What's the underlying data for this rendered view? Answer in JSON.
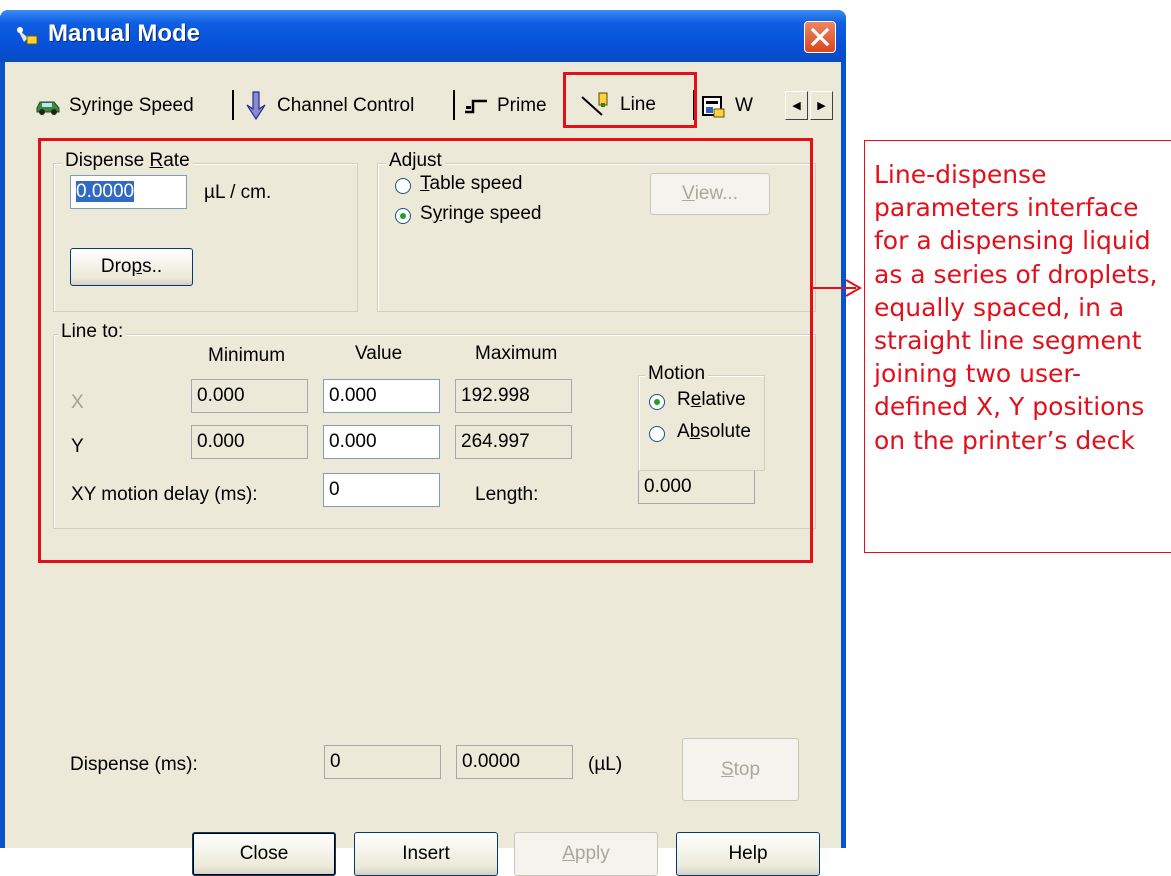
{
  "window": {
    "title": "Manual Mode"
  },
  "tabs": [
    {
      "label": "Syringe Speed",
      "icon": "car-icon"
    },
    {
      "label": "Channel Control",
      "icon": "down-arrow-icon"
    },
    {
      "label": "Prime",
      "icon": "prime-icon"
    },
    {
      "label": "Line",
      "icon": "line-pen-icon",
      "selected": true
    },
    {
      "label": "W",
      "icon": "printer-icon"
    }
  ],
  "dispense_rate": {
    "legend": "Dispense Rate",
    "value": "0.0000",
    "unit": "µL / cm.",
    "drops_button": "Drops.."
  },
  "adjust": {
    "legend": "Adjust",
    "options": [
      "Table speed",
      "Syringe speed"
    ],
    "selected": "Syringe speed",
    "view_button": "View..."
  },
  "line_to": {
    "legend": "Line to:",
    "headers": {
      "minimum": "Minimum",
      "value": "Value",
      "maximum": "Maximum"
    },
    "x": {
      "label": "X",
      "minimum": "0.000",
      "value": "0.000",
      "maximum": "192.998"
    },
    "y": {
      "label": "Y",
      "minimum": "0.000",
      "value": "0.000",
      "maximum": "264.997"
    },
    "delay_label": "XY motion delay (ms):",
    "delay_value": "0",
    "length_label": "Length:",
    "length_value": "0.000",
    "motion": {
      "legend": "Motion",
      "options": [
        "Relative",
        "Absolute"
      ],
      "selected": "Relative"
    }
  },
  "dispense": {
    "label": "Dispense (ms):",
    "ms_value": "0",
    "ul_value": "0.0000",
    "unit": "(µL)",
    "stop_button": "Stop"
  },
  "footer_buttons": {
    "close": "Close",
    "insert": "Insert",
    "apply": "Apply",
    "help": "Help"
  },
  "annotation": {
    "text": "Line-dispense parameters interface for a dispensing liquid as a series of droplets, equally spaced, in a straight line segment joining two user-defined X, Y positions on the printer’s deck",
    "color": "#e3101b"
  }
}
